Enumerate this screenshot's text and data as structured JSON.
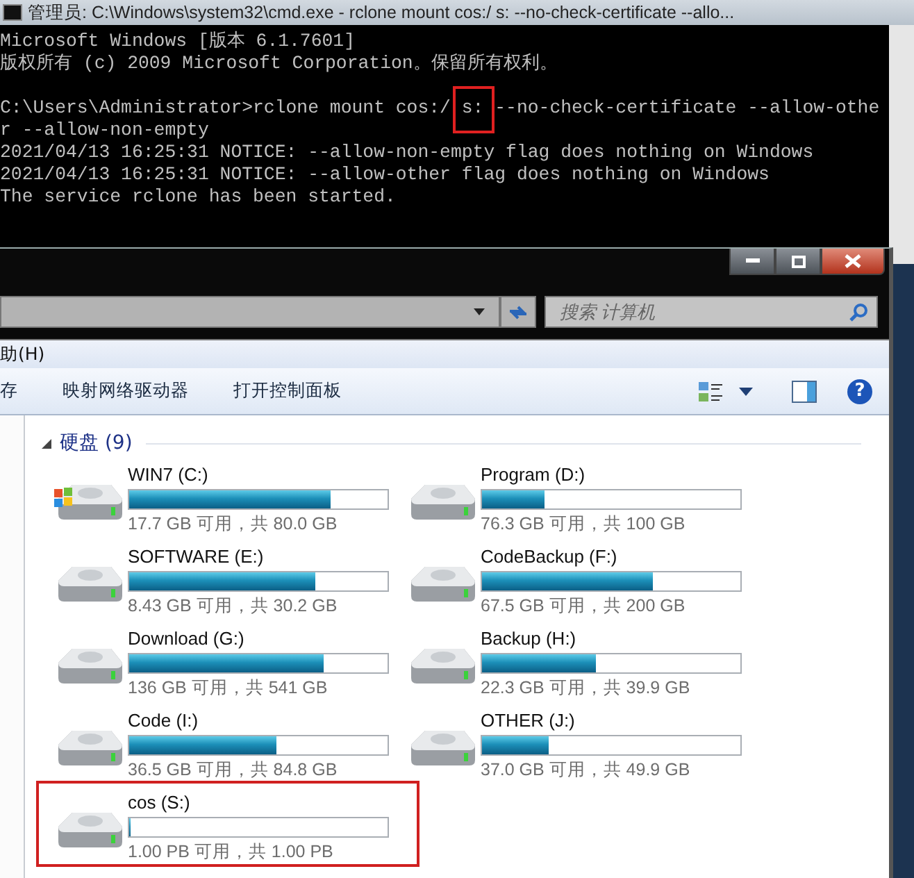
{
  "console_window": {
    "title": "管理员: C:\\Windows\\system32\\cmd.exe - rclone  mount cos:/ s: --no-check-certificate --allo...",
    "lines": [
      "Microsoft Windows [版本 6.1.7601]",
      "版权所有 (c) 2009 Microsoft Corporation。保留所有权利。",
      "C:\\Users\\Administrator>rclone mount cos:/ s: --no-check-certificate --allow-othe",
      "r --allow-non-empty",
      "2021/04/13 16:25:31 NOTICE: --allow-non-empty flag does nothing on Windows",
      "2021/04/13 16:25:31 NOTICE: --allow-other flag does nothing on Windows",
      "The service rclone has been started."
    ]
  },
  "explorer": {
    "search": {
      "placeholder": "搜索 计算机"
    },
    "menu": [
      "助(H)"
    ],
    "toolbar": [
      "存",
      "映射网络驱动器",
      "打开控制面板"
    ],
    "help": "?",
    "group": {
      "label": "硬盘 (9)",
      "expanded": true
    },
    "drives": [
      {
        "kind": "system",
        "name": "WIN7 (C:)",
        "level": 0.78,
        "space": "17.7 GB 可用，共 80.0 GB"
      },
      {
        "kind": "drive",
        "name": "Program (D:)",
        "level": 0.24,
        "space": "76.3 GB 可用，共 100 GB"
      },
      {
        "kind": "drive",
        "name": "SOFTWARE (E:)",
        "level": 0.72,
        "space": "8.43 GB 可用，共 30.2 GB"
      },
      {
        "kind": "drive",
        "name": "CodeBackup (F:)",
        "level": 0.66,
        "space": "67.5 GB 可用，共 200 GB"
      },
      {
        "kind": "drive",
        "name": "Download (G:)",
        "level": 0.75,
        "space": "136 GB 可用，共 541 GB"
      },
      {
        "kind": "drive",
        "name": "Backup (H:)",
        "level": 0.44,
        "space": "22.3 GB 可用，共 39.9 GB"
      },
      {
        "kind": "drive",
        "name": "Code (I:)",
        "level": 0.57,
        "space": "36.5 GB 可用，共 84.8 GB"
      },
      {
        "kind": "drive",
        "name": "OTHER (J:)",
        "level": 0.26,
        "space": "37.0 GB 可用，共 49.9 GB"
      },
      {
        "kind": "drive",
        "name": "cos (S:)",
        "level": 0,
        "space": "1.00 PB 可用，共 1.00 PB"
      }
    ]
  }
}
